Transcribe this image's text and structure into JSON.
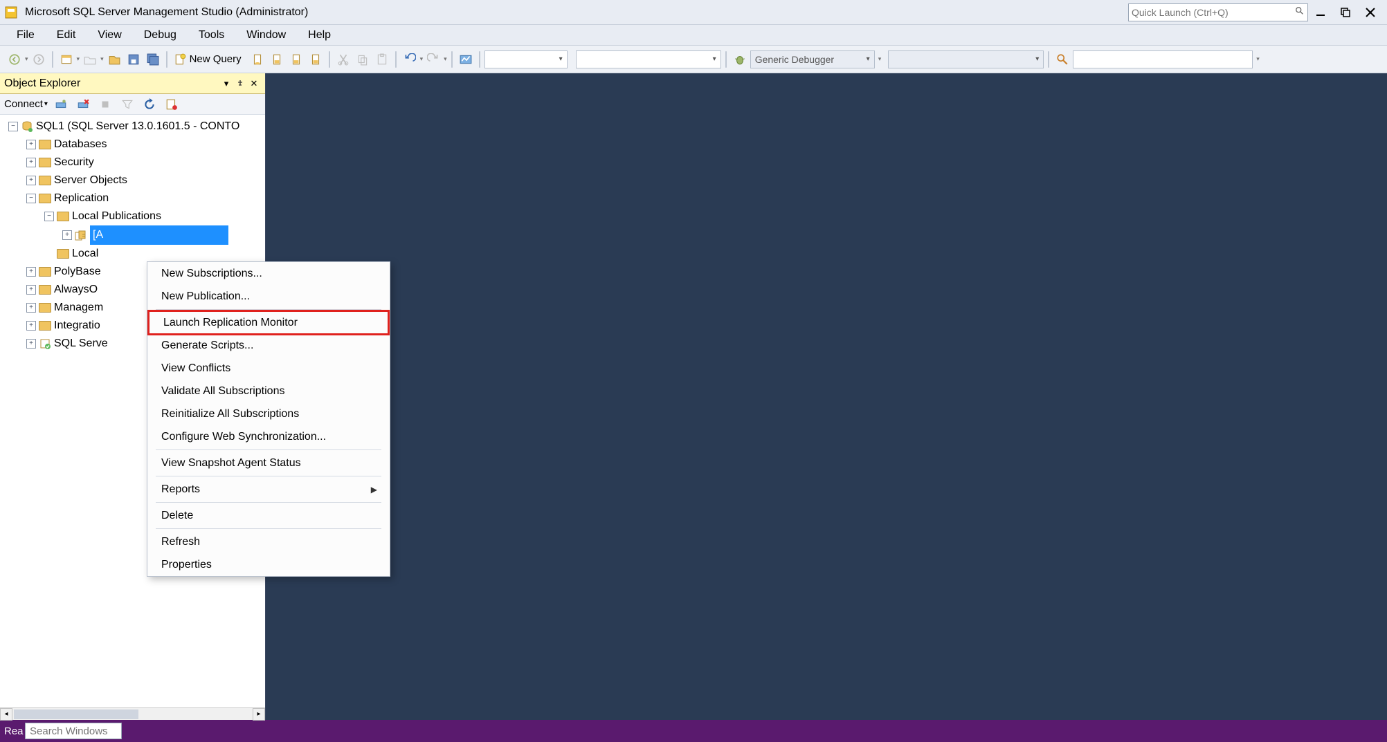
{
  "title": "Microsoft SQL Server Management Studio (Administrator)",
  "quicklaunch_placeholder": "Quick Launch (Ctrl+Q)",
  "menus": {
    "file": "File",
    "edit": "Edit",
    "view": "View",
    "debug": "Debug",
    "tools": "Tools",
    "window": "Window",
    "help": "Help"
  },
  "toolbar": {
    "newquery": "New Query",
    "debugger_label": "Generic Debugger"
  },
  "panel": {
    "title": "Object Explorer",
    "connect": "Connect"
  },
  "tree": {
    "server": "SQL1 (SQL Server 13.0.1601.5 - CONTO",
    "databases": "Databases",
    "security": "Security",
    "server_objects": "Server Objects",
    "replication": "Replication",
    "local_publications": "Local Publications",
    "publication_selected": "[A",
    "local_subscriptions": "Local",
    "polybase": "PolyBase",
    "alwayson": "AlwaysO",
    "management": "Managem",
    "integration": "Integratio",
    "sqlagent": "SQL Serve"
  },
  "ctx": [
    {
      "label": "New Subscriptions..."
    },
    {
      "label": "New Publication..."
    },
    {
      "sep": true
    },
    {
      "label": "Launch Replication Monitor",
      "highlight": true
    },
    {
      "label": "Generate Scripts..."
    },
    {
      "label": "View Conflicts"
    },
    {
      "label": "Validate All Subscriptions"
    },
    {
      "label": "Reinitialize All Subscriptions"
    },
    {
      "label": "Configure Web Synchronization..."
    },
    {
      "sep": true
    },
    {
      "label": "View Snapshot Agent Status"
    },
    {
      "sep": true
    },
    {
      "label": "Reports",
      "submenu": true
    },
    {
      "sep": true
    },
    {
      "label": "Delete"
    },
    {
      "sep": true
    },
    {
      "label": "Refresh"
    },
    {
      "label": "Properties"
    }
  ],
  "statusbar": {
    "left": "Rea",
    "search_placeholder": "Search Windows"
  }
}
